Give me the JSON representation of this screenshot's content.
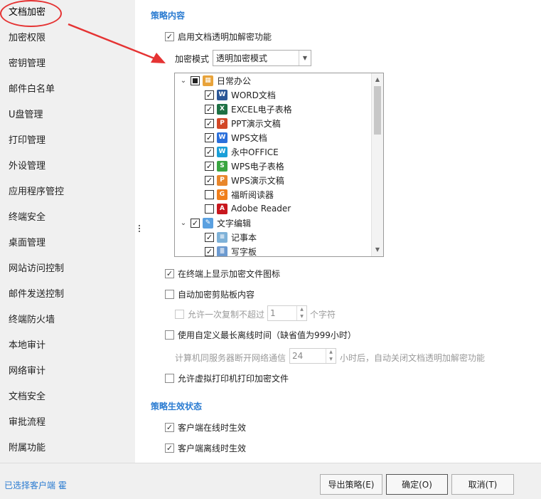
{
  "sidebar": {
    "items": [
      {
        "label": "文档加密"
      },
      {
        "label": "加密权限"
      },
      {
        "label": "密钥管理"
      },
      {
        "label": "邮件白名单"
      },
      {
        "label": "U盘管理"
      },
      {
        "label": "打印管理"
      },
      {
        "label": "外设管理"
      },
      {
        "label": "应用程序管控"
      },
      {
        "label": "终端安全"
      },
      {
        "label": "桌面管理"
      },
      {
        "label": "网站访问控制"
      },
      {
        "label": "邮件发送控制"
      },
      {
        "label": "终端防火墙"
      },
      {
        "label": "本地审计"
      },
      {
        "label": "网络审计"
      },
      {
        "label": "文档安全"
      },
      {
        "label": "审批流程"
      },
      {
        "label": "附属功能"
      }
    ],
    "active_index": 0
  },
  "policy_content": {
    "title": "策略内容",
    "enable_transparent": {
      "label": "启用文档透明加解密功能",
      "checked": true
    },
    "mode_label": "加密模式",
    "mode_value": "透明加密模式",
    "tree": [
      {
        "label": "日常办公",
        "level": 0,
        "state": "partial",
        "icon": "office-group-icon"
      },
      {
        "label": "WORD文档",
        "level": 1,
        "state": "checked",
        "icon": "word-icon"
      },
      {
        "label": "EXCEL电子表格",
        "level": 1,
        "state": "checked",
        "icon": "excel-icon"
      },
      {
        "label": "PPT演示文稿",
        "level": 1,
        "state": "checked",
        "icon": "ppt-icon"
      },
      {
        "label": "WPS文档",
        "level": 1,
        "state": "checked",
        "icon": "wps-writer-icon"
      },
      {
        "label": "永中OFFICE",
        "level": 1,
        "state": "checked",
        "icon": "yozo-icon"
      },
      {
        "label": "WPS电子表格",
        "level": 1,
        "state": "checked",
        "icon": "wps-sheet-icon"
      },
      {
        "label": "WPS演示文稿",
        "level": 1,
        "state": "checked",
        "icon": "wps-presentation-icon"
      },
      {
        "label": "福昕阅读器",
        "level": 1,
        "state": "unchecked",
        "icon": "foxit-icon"
      },
      {
        "label": "Adobe Reader",
        "level": 1,
        "state": "unchecked",
        "icon": "adobe-icon"
      },
      {
        "label": "文字编辑",
        "level": 0,
        "state": "checked",
        "icon": "text-edit-group-icon"
      },
      {
        "label": "记事本",
        "level": 1,
        "state": "checked",
        "icon": "notepad-icon"
      },
      {
        "label": "写字板",
        "level": 1,
        "state": "checked",
        "icon": "wordpad-icon"
      }
    ],
    "show_icon": {
      "label": "在终端上显示加密文件图标",
      "checked": true
    },
    "auto_clipboard": {
      "label": "自动加密剪贴板内容",
      "checked": false
    },
    "allow_copy": {
      "label": "允许一次复制不超过",
      "value": "1",
      "suffix": "个字符",
      "checked": false
    },
    "custom_offline": {
      "label": "使用自定义最长离线时间（缺省值为999小时）",
      "checked": false
    },
    "offline_prefix": "计算机同服务器断开网络通信",
    "offline_value": "24",
    "offline_suffix": "小时后，自动关闭文档透明加解密功能",
    "virtual_printer": {
      "label": "允许虚拟打印机打印加密文件",
      "checked": false
    }
  },
  "policy_status": {
    "title": "策略生效状态",
    "online": {
      "label": "客户端在线时生效",
      "checked": true
    },
    "offline": {
      "label": "客户端离线时生效",
      "checked": true
    }
  },
  "footer": {
    "selected_clients": "已选择客户端 霍",
    "export_label": "导出策略(E)",
    "ok_label": "确定(O)",
    "cancel_label": "取消(T)"
  },
  "colors": {
    "accent": "#2a7bd1",
    "annotation": "#e53333"
  }
}
